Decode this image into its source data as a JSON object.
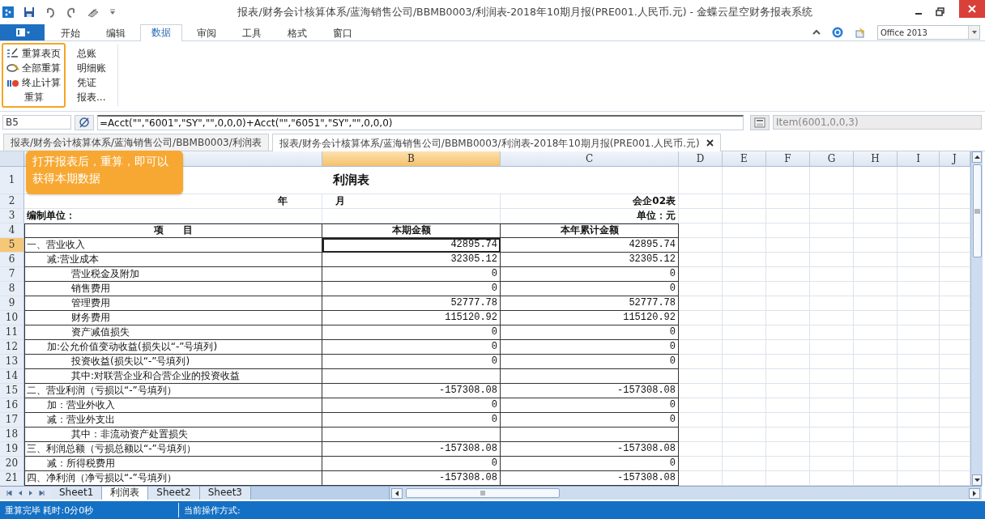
{
  "window": {
    "title": "报表/财务会计核算体系/蓝海销售公司/BBMB0003/利润表-2018年10期月报(PRE001.人民币.元) - 金蝶云星空财务报表系统"
  },
  "ribbon": {
    "tabs": [
      {
        "label": "开始",
        "selected": false
      },
      {
        "label": "编辑",
        "selected": false
      },
      {
        "label": "数据",
        "selected": true
      },
      {
        "label": "审阅",
        "selected": false
      },
      {
        "label": "工具",
        "selected": false
      },
      {
        "label": "格式",
        "selected": false
      },
      {
        "label": "窗口",
        "selected": false
      }
    ],
    "theme": "Office 2013",
    "groups": [
      {
        "label": "重算",
        "highlighted": true,
        "items": [
          {
            "label": "重算表页"
          },
          {
            "label": "全部重算"
          },
          {
            "label": "终止计算"
          }
        ]
      },
      {
        "items": [
          {
            "label": "总账"
          },
          {
            "label": "明细账"
          },
          {
            "label": "凭证"
          },
          {
            "label": "报表..."
          }
        ]
      }
    ]
  },
  "formula_bar": {
    "cell_ref": "B5",
    "formula": "=Acct(\"\",\"6001\",\"SY\",\"\",0,0,0)+Acct(\"\",\"6051\",\"SY\",\"\",0,0,0)",
    "item_ref": "Item(6001,0,0,3)"
  },
  "document_tabs": [
    {
      "label": "报表/财务会计核算体系/蓝海销售公司/BBMB0003/利润表",
      "selected": false,
      "closable": false
    },
    {
      "label": "报表/财务会计核算体系/蓝海销售公司/BBMB0003/利润表-2018年10期月报(PRE001.人民币.元)",
      "selected": true,
      "closable": true
    }
  ],
  "sheet": {
    "columns": [
      {
        "label": "B",
        "selected": true
      },
      {
        "label": "C",
        "selected": false
      },
      {
        "label": "D",
        "selected": false
      },
      {
        "label": "E",
        "selected": false
      },
      {
        "label": "F",
        "selected": false
      },
      {
        "label": "G",
        "selected": false
      },
      {
        "label": "H",
        "selected": false
      },
      {
        "label": "I",
        "selected": false
      },
      {
        "label": "J",
        "selected": false
      }
    ],
    "rows": [
      {
        "number": "1",
        "selected": false,
        "kind": "title",
        "text": "利润表"
      },
      {
        "number": "2",
        "selected": false,
        "kind": "period",
        "year": "年",
        "month": "月",
        "form_no": "会企02表"
      },
      {
        "number": "3",
        "selected": false,
        "kind": "unit",
        "company": "编制单位：",
        "unit": "单位：元"
      },
      {
        "number": "4",
        "selected": false,
        "kind": "head",
        "cells": [
          "项　　目",
          "本期金额",
          "本年累计金额"
        ]
      },
      {
        "number": "5",
        "selected": true,
        "kind": "main",
        "item": "一、营业收入",
        "values": [
          "42895.74",
          "42895.74"
        ]
      },
      {
        "number": "6",
        "selected": false,
        "kind": "sub",
        "item": "减:营业成本",
        "values": [
          "32305.12",
          "32305.12"
        ]
      },
      {
        "number": "7",
        "selected": false,
        "kind": "detail",
        "item": "营业税金及附加",
        "values": [
          "0",
          "0"
        ]
      },
      {
        "number": "8",
        "selected": false,
        "kind": "detail",
        "item": "销售费用",
        "values": [
          "0",
          "0"
        ]
      },
      {
        "number": "9",
        "selected": false,
        "kind": "detail",
        "item": "管理费用",
        "values": [
          "52777.78",
          "52777.78"
        ]
      },
      {
        "number": "10",
        "selected": false,
        "kind": "detail",
        "item": "财务费用",
        "values": [
          "115120.92",
          "115120.92"
        ]
      },
      {
        "number": "11",
        "selected": false,
        "kind": "detail",
        "item": "资产减值损失",
        "values": [
          "0",
          "0"
        ]
      },
      {
        "number": "12",
        "selected": false,
        "kind": "sub",
        "item": "加:公允价值变动收益(损失以“-”号填列)",
        "values": [
          "0",
          "0"
        ]
      },
      {
        "number": "13",
        "selected": false,
        "kind": "detail",
        "item": "投资收益(损失以“-”号填列)",
        "values": [
          "0",
          "0"
        ]
      },
      {
        "number": "14",
        "selected": false,
        "kind": "detail",
        "item": "其中:对联营企业和合营企业的投资收益"
      },
      {
        "number": "15",
        "selected": false,
        "kind": "main",
        "item": "二、营业利润（亏损以“-”号填列）",
        "values": [
          "-157308.08",
          "-157308.08"
        ]
      },
      {
        "number": "16",
        "selected": false,
        "kind": "sub",
        "item": "加：营业外收入",
        "values": [
          "0",
          "0"
        ]
      },
      {
        "number": "17",
        "selected": false,
        "kind": "sub",
        "item": "减：营业外支出",
        "values": [
          "0",
          "0"
        ]
      },
      {
        "number": "18",
        "selected": false,
        "kind": "detail",
        "item": "其中：非流动资产处置损失"
      },
      {
        "number": "19",
        "selected": false,
        "kind": "main",
        "item": "三、利润总额（亏损总额以“-”号填列）",
        "values": [
          "-157308.08",
          "-157308.08"
        ]
      },
      {
        "number": "20",
        "selected": false,
        "kind": "sub",
        "item": "减：所得税费用",
        "values": [
          "0",
          "0"
        ]
      },
      {
        "number": "21",
        "selected": false,
        "kind": "main",
        "item": "四、净利润（净亏损以“-”号填列）",
        "values": [
          "-157308.08",
          "-157308.08"
        ]
      }
    ]
  },
  "sheet_tabs": [
    {
      "label": "Sheet1",
      "selected": false
    },
    {
      "label": "利润表",
      "selected": true
    },
    {
      "label": "Sheet2",
      "selected": false
    },
    {
      "label": "Sheet3",
      "selected": false
    }
  ],
  "status_bar": {
    "message": "重算完毕 耗时:0分0秒",
    "mode": "当前操作方式:"
  },
  "callout": {
    "text": "打开报表后，重算，即可以获得本期数据"
  }
}
